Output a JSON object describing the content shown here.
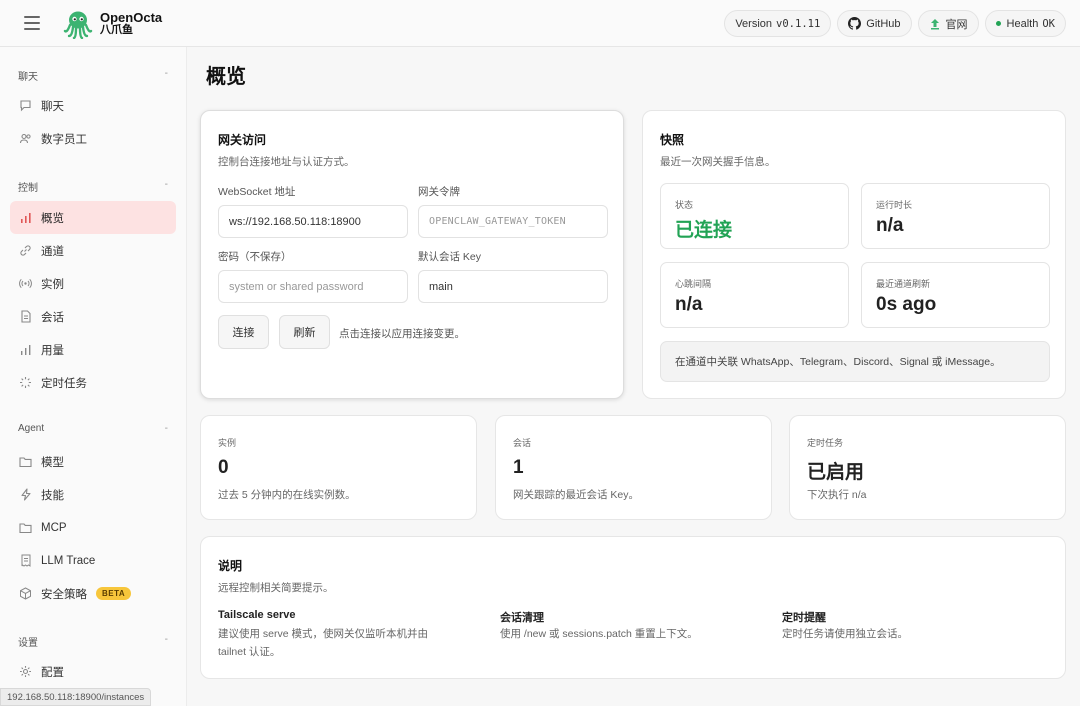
{
  "app": {
    "name": "OpenOcta",
    "subname": "八爪鱼"
  },
  "topbar": {
    "version_label": "Version",
    "version_value": "v0.1.11",
    "github_label": "GitHub",
    "site_label": "官网",
    "health_label": "Health",
    "health_value": "OK"
  },
  "sidebar": {
    "groups": [
      {
        "label": "聊天",
        "items": [
          {
            "label": "聊天",
            "icon": "chat-icon"
          },
          {
            "label": "数字员工",
            "icon": "users-icon"
          }
        ]
      },
      {
        "label": "控制",
        "items": [
          {
            "label": "概览",
            "icon": "bar-chart-icon",
            "active": true
          },
          {
            "label": "通道",
            "icon": "link-icon"
          },
          {
            "label": "实例",
            "icon": "broadcast-icon"
          },
          {
            "label": "会话",
            "icon": "document-icon"
          },
          {
            "label": "用量",
            "icon": "bar-chart-icon"
          },
          {
            "label": "定时任务",
            "icon": "loader-icon"
          }
        ]
      },
      {
        "label": "Agent",
        "items": [
          {
            "label": "模型",
            "icon": "folder-icon"
          },
          {
            "label": "技能",
            "icon": "bolt-icon"
          },
          {
            "label": "MCP",
            "icon": "folder-icon"
          },
          {
            "label": "LLM Trace",
            "icon": "receipt-icon"
          },
          {
            "label": "安全策略",
            "icon": "cube-icon",
            "badge": "BETA"
          }
        ]
      },
      {
        "label": "设置",
        "items": [
          {
            "label": "配置",
            "icon": "gear-icon"
          }
        ]
      }
    ]
  },
  "status_url": "192.168.50.118:18900/instances",
  "page": {
    "title": "概览"
  },
  "gateway": {
    "title": "网关访问",
    "subtitle": "控制台连接地址与认证方式。",
    "ws_label": "WebSocket 地址",
    "ws_value": "ws://192.168.50.118:18900",
    "token_label": "网关令牌",
    "token_placeholder": "OPENCLAW_GATEWAY_TOKEN",
    "password_label": "密码（不保存）",
    "password_placeholder": "system or shared password",
    "session_label": "默认会话 Key",
    "session_value": "main",
    "connect_label": "连接",
    "refresh_label": "刷新",
    "hint": "点击连接以应用连接变更。"
  },
  "snapshot": {
    "title": "快照",
    "subtitle": "最近一次网关握手信息。",
    "stats": [
      {
        "label": "状态",
        "value": "已连接",
        "color": "#22a355"
      },
      {
        "label": "运行时长",
        "value": "n/a"
      },
      {
        "label": "心跳间隔",
        "value": "n/a"
      },
      {
        "label": "最近通道刷新",
        "value": "0s ago"
      }
    ],
    "notice": "在通道中关联 WhatsApp、Telegram、Discord、Signal 或 iMessage。"
  },
  "metrics": [
    {
      "label": "实例",
      "value": "0",
      "desc": "过去 5 分钟内的在线实例数。"
    },
    {
      "label": "会话",
      "value": "1",
      "desc": "网关跟踪的最近会话 Key。"
    },
    {
      "label": "定时任务",
      "value": "已启用",
      "desc": "下次执行 n/a"
    }
  ],
  "notes": {
    "title": "说明",
    "subtitle": "远程控制相关简要提示。",
    "items": [
      {
        "title": "Tailscale serve",
        "desc_line1": "建议使用 serve 模式，使网关仅监听本机并由",
        "desc_line2": "tailnet 认证。"
      },
      {
        "title": "会话清理",
        "desc_line1": "使用 /new 或 sessions.patch 重置上下文。"
      },
      {
        "title": "定时提醒",
        "desc_line1": "定时任务请使用独立会话。"
      }
    ]
  },
  "colors": {
    "accent": "#e05656",
    "success": "#22a355",
    "active_bg": "#fde2e2",
    "beta": "#f7c63b"
  }
}
